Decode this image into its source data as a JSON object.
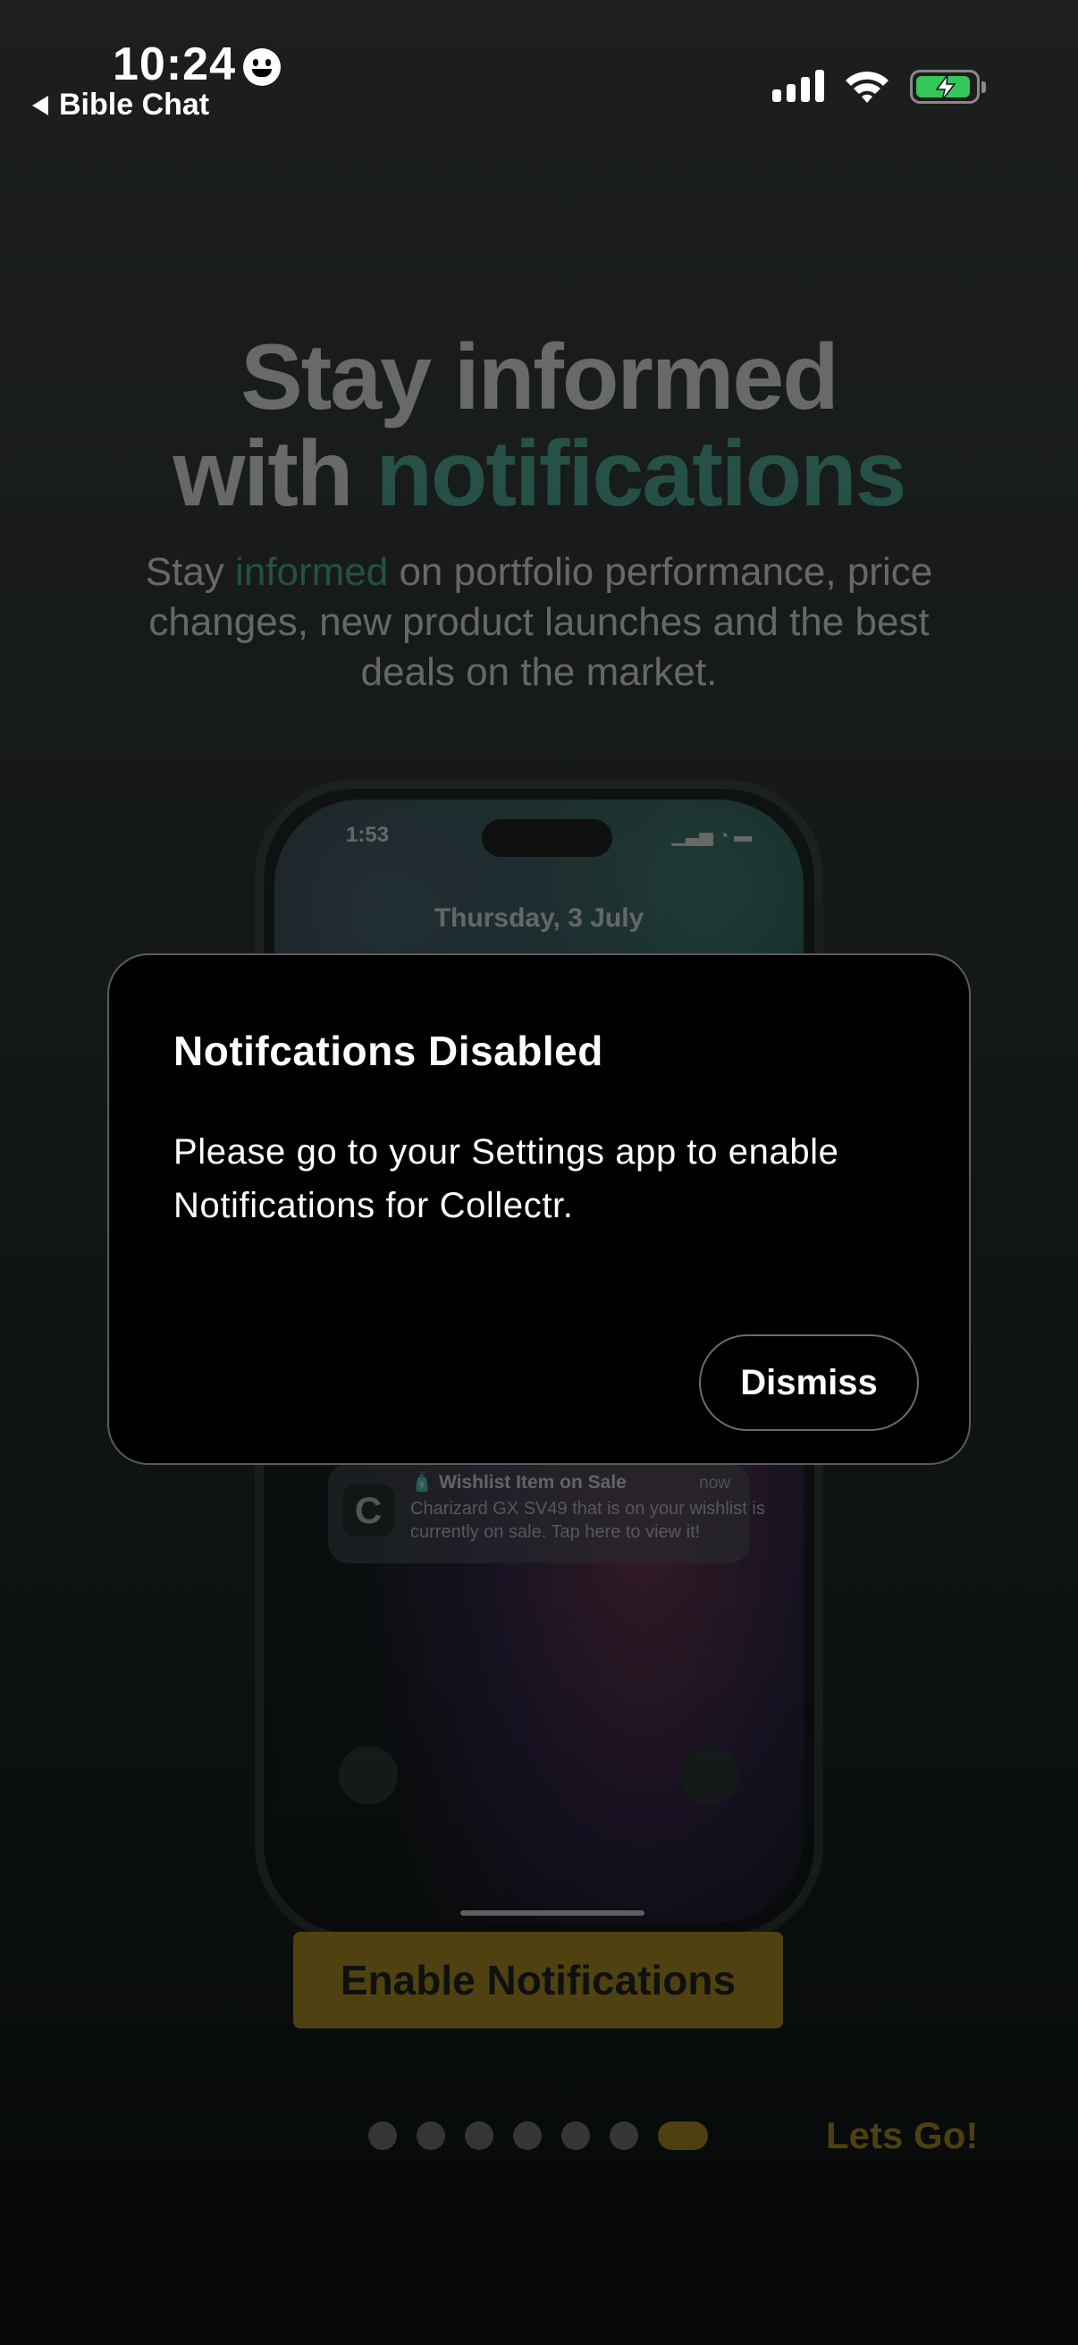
{
  "status_bar": {
    "time": "10:24",
    "back_label": "Bible Chat",
    "signal_bars": 4,
    "battery_charging": true
  },
  "background": {
    "title_line1": "Stay informed",
    "title_line2_prefix": "with ",
    "title_line2_accent": "notifications",
    "subtitle_prefix": "Stay ",
    "subtitle_accent": "informed",
    "subtitle_rest": " on portfolio performance, price changes, new product launches and the best deals on the market.",
    "phone": {
      "time": "1:53",
      "date": "Thursday, 3 July",
      "notification_title": "🧴 Wishlist Item on Sale",
      "notification_time": "now",
      "notification_body": "Charizard GX SV49 that is on your wishlist is currently on sale. Tap here to view it!"
    },
    "enable_button_label": "Enable Notifications",
    "page_count": 7,
    "active_page": 7,
    "next_label": "Lets Go!"
  },
  "dialog": {
    "title": "Notifcations Disabled",
    "body": "Please go to your Settings app to enable Notifications for Collectr.",
    "dismiss_label": "Dismiss"
  },
  "colors": {
    "accent_teal": "#3fb8a0",
    "accent_gold": "#d6a818",
    "dialog_bg": "#000000"
  }
}
